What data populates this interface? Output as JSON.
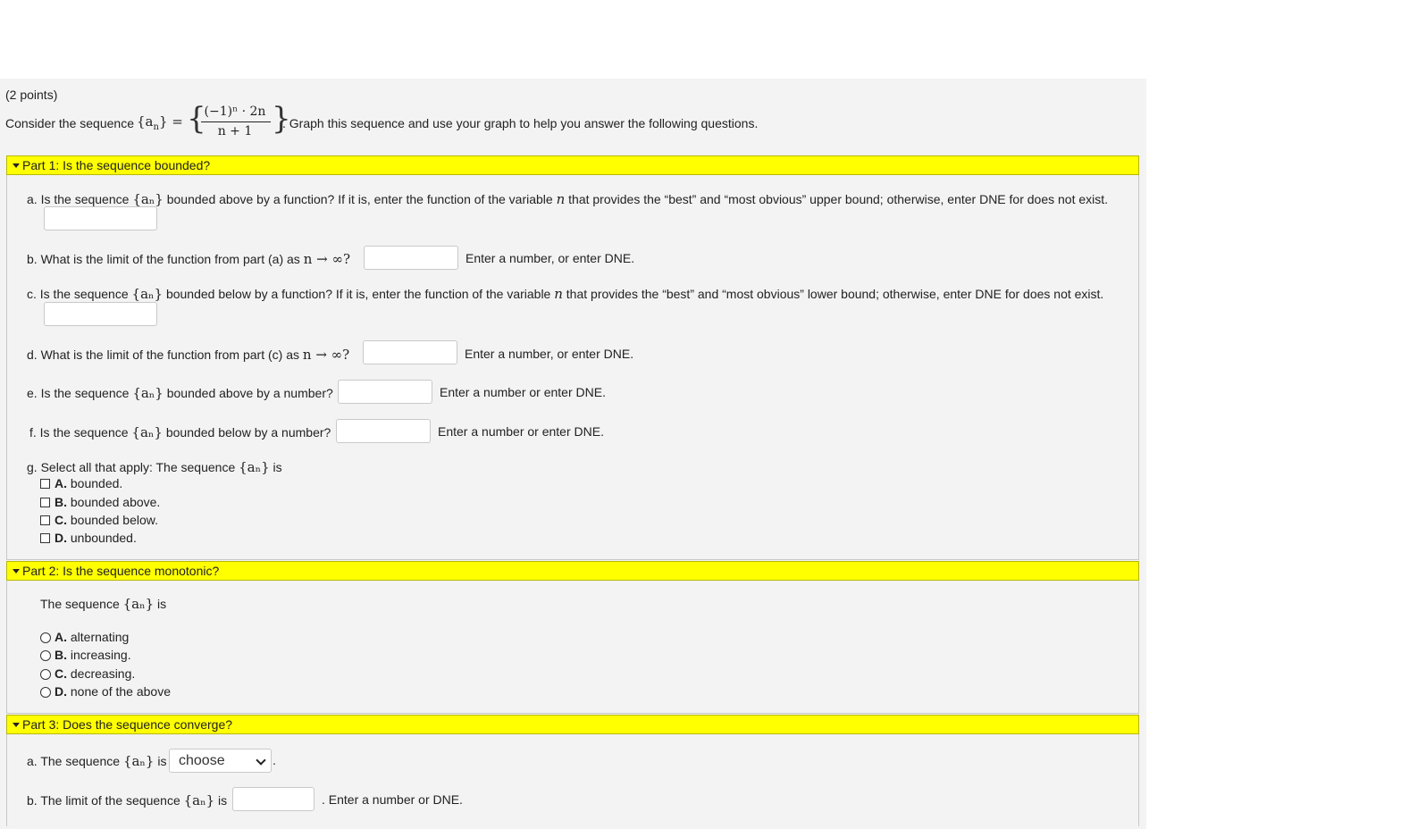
{
  "points": "(2 points)",
  "intro": {
    "prefix": "Consider the sequence",
    "seq": "{a",
    "seq_sub": "n",
    "seq_close": "} =",
    "numerator": "(−1)ⁿ · 2n",
    "denominator": "n + 1",
    "suffix": ". Graph this sequence and use your graph to help you answer the following questions."
  },
  "part1": {
    "title": "Part 1: Is the sequence bounded?",
    "a_text_1": "a. Is the sequence",
    "a_text_2": "bounded above by a function? If it is, enter the function of the variable",
    "a_text_3": "that provides the “best” and “most obvious” upper bound; otherwise, enter DNE for does not exist.",
    "b_text": "b. What is the limit of the function from part (a) as",
    "b_hint": "Enter a number, or enter DNE.",
    "c_text_1": "c. Is the sequence",
    "c_text_2": "bounded below by a function? If it is, enter the function of the variable",
    "c_text_3": "that provides the “best” and “most obvious” lower bound; otherwise, enter DNE for does not exist.",
    "d_text": "d. What is the limit of the function from part (c) as",
    "d_hint": "Enter a number, or enter DNE.",
    "e_text_1": "e. Is the sequence",
    "e_text_2": "bounded above by a number?",
    "e_hint": "Enter a number or enter DNE.",
    "f_text_1": "f. Is the sequence",
    "f_text_2": "bounded below by a number?",
    "f_hint": "Enter a number or enter DNE.",
    "g_text_1": "g. Select all that apply: The sequence",
    "g_text_2": "is",
    "options": [
      {
        "letter": "A.",
        "label": "bounded."
      },
      {
        "letter": "B.",
        "label": "bounded above."
      },
      {
        "letter": "C.",
        "label": "bounded below."
      },
      {
        "letter": "D.",
        "label": "unbounded."
      }
    ]
  },
  "part2": {
    "title": "Part 2: Is the sequence monotonic?",
    "text_1": "The sequence",
    "text_2": "is",
    "options": [
      {
        "letter": "A.",
        "label": "alternating"
      },
      {
        "letter": "B.",
        "label": "increasing."
      },
      {
        "letter": "C.",
        "label": "decreasing."
      },
      {
        "letter": "D.",
        "label": "none of the above"
      }
    ]
  },
  "part3": {
    "title": "Part 3: Does the sequence converge?",
    "a_text_1": "a. The sequence",
    "a_text_2": "is",
    "select_value": "choose",
    "b_text_1": "b. The limit of the sequence",
    "b_text_2": "is",
    "b_hint": ". Enter a number or DNE."
  },
  "math": {
    "an": "{aₙ}",
    "n": "n",
    "n_to_inf": "n → ∞?"
  }
}
